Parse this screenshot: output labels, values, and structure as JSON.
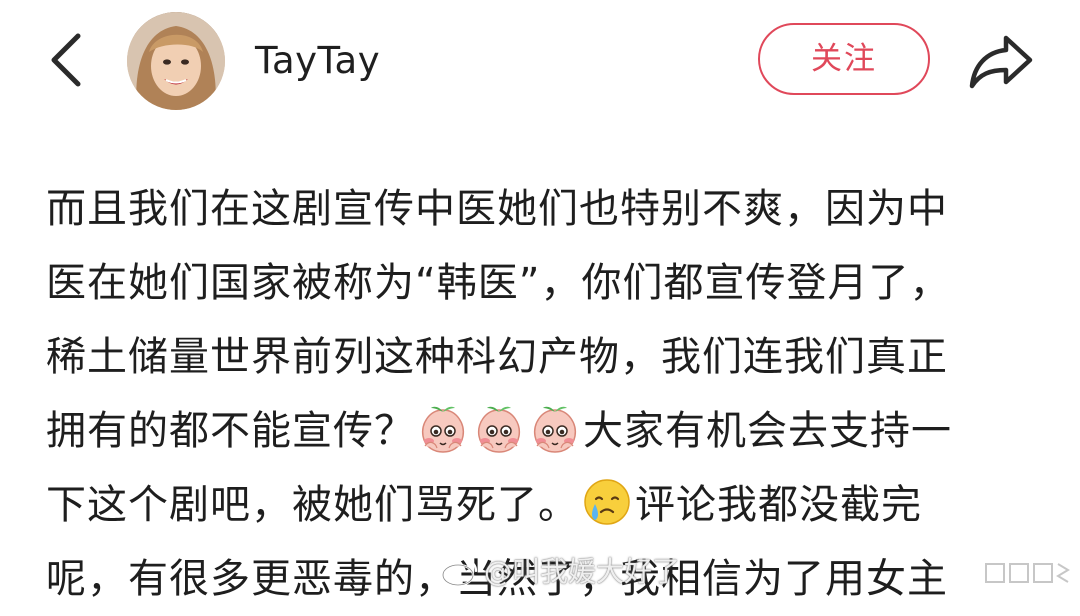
{
  "header": {
    "back_icon": "chevron-left-icon",
    "username": "TayTay",
    "follow_label": "关注",
    "share_icon": "share-arrow-icon",
    "accent_color": "#e0485a"
  },
  "post": {
    "lines": [
      "而且我们在这剧宣传中医她们也特别不爽，因为中",
      "医在她们国家被称为“韩医”，你们都宣传登月了，",
      "稀土储量世界前列这种科幻产物，我们连我们真正",
      "拥有的都不能宣传？",
      "大家有机会去支持一",
      "下这个剧吧，被她们骂死了。",
      "评论我都没截完",
      "呢，有很多更恶毒的，当然了，我相信为了用女主"
    ],
    "emojis": [
      "blush-peach-emoji",
      "blush-peach-emoji",
      "blush-peach-emoji",
      "teary-smile-emoji"
    ]
  },
  "watermark": {
    "text": "@叫我媛大好了"
  }
}
